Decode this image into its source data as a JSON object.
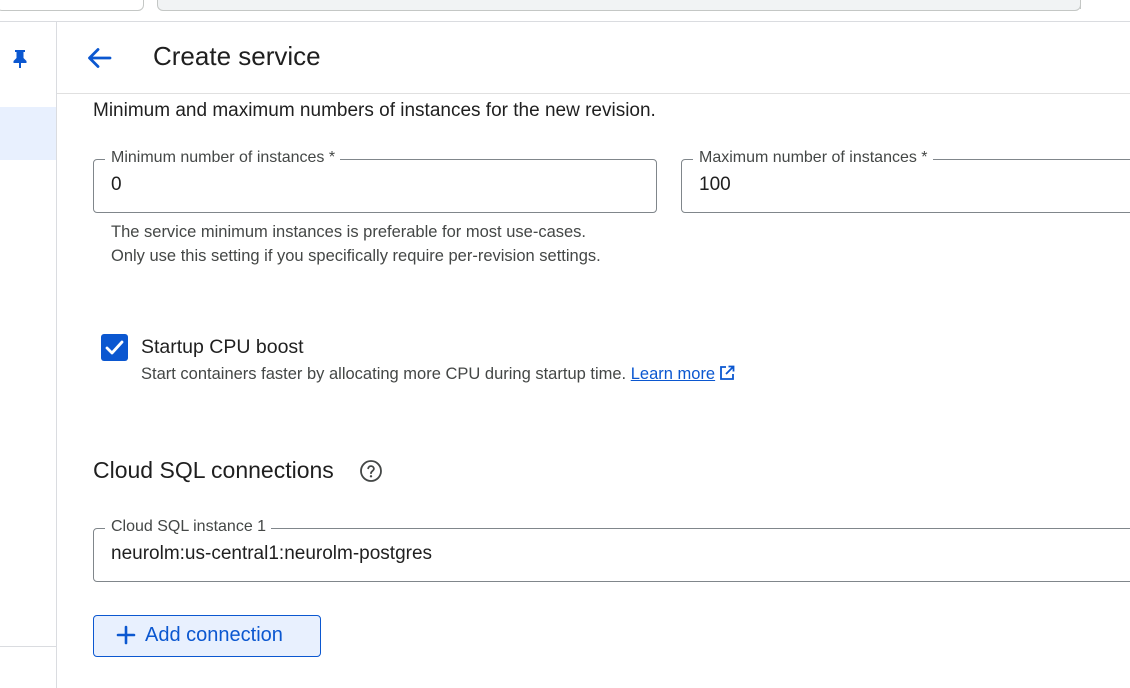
{
  "header": {
    "title": "Create service",
    "back_icon": "arrow-back-icon"
  },
  "rail": {
    "pin_icon": "pin-icon"
  },
  "scaling": {
    "description": "Minimum and maximum numbers of instances for the new revision.",
    "min_label": "Minimum number of instances *",
    "min_value": "0",
    "max_label": "Maximum number of instances *",
    "max_value": "100",
    "min_hint": "The service minimum instances is preferable for most use-cases. Only use this setting if you specifically require per-revision settings."
  },
  "startup_boost": {
    "checked": true,
    "label": "Startup CPU boost",
    "description": "Start containers faster by allocating more CPU during startup time.",
    "learn_more": "Learn more"
  },
  "cloud_sql": {
    "heading": "Cloud SQL connections",
    "instance_label": "Cloud SQL instance 1",
    "instance_value": "neurolm:us-central1:neurolm-postgres",
    "add_button": "Add connection"
  },
  "colors": {
    "accent": "#0b57d0",
    "button_bg": "#e8f0fe",
    "text": "#1f1f1f",
    "muted": "#444746"
  }
}
